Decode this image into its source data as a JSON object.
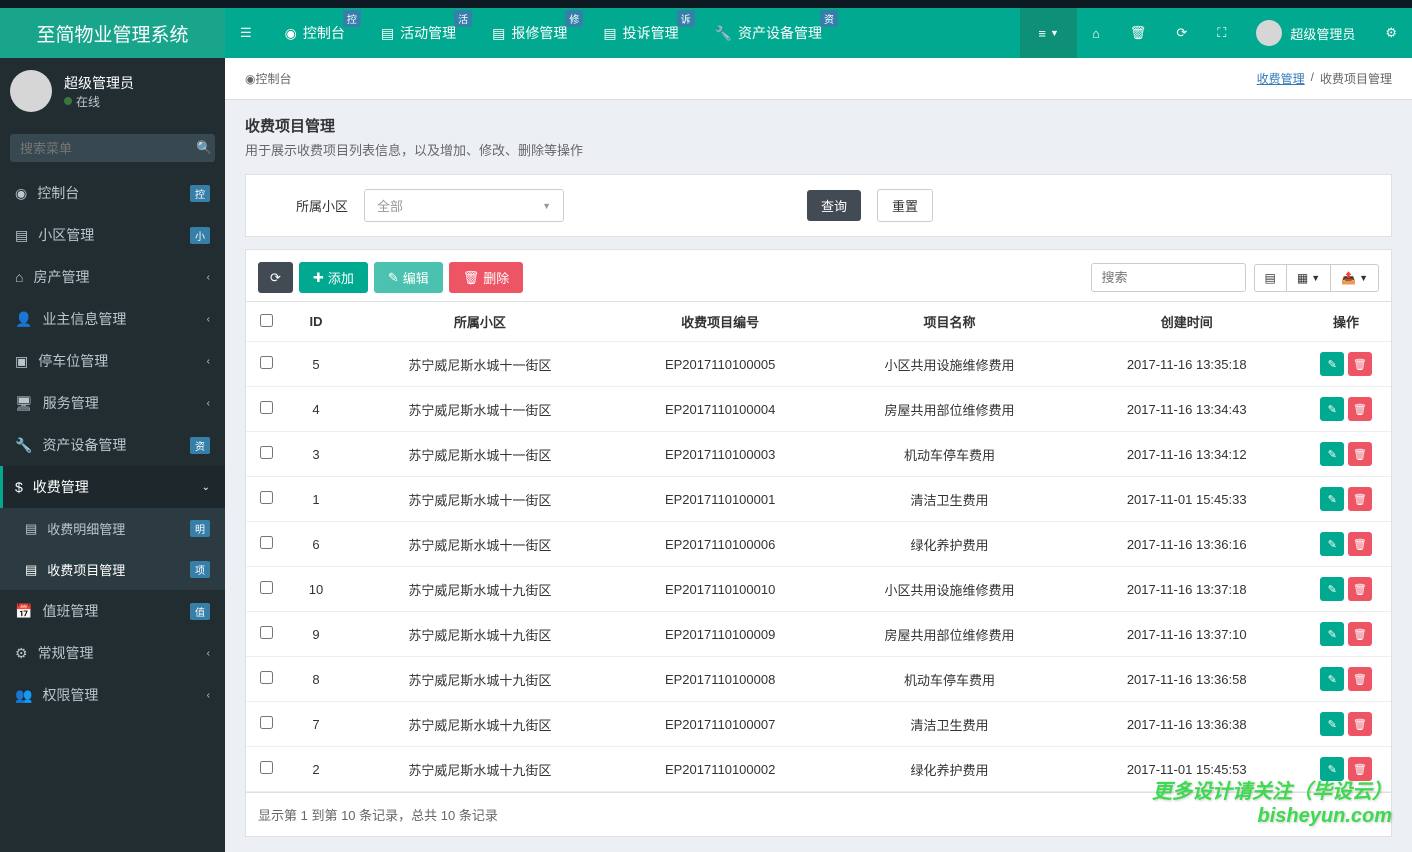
{
  "app_title": "至简物业管理系统",
  "top_nav": [
    {
      "label": "控制台",
      "badge": "控"
    },
    {
      "label": "活动管理",
      "badge": "活"
    },
    {
      "label": "报修管理",
      "badge": "修"
    },
    {
      "label": "投诉管理",
      "badge": "诉"
    },
    {
      "label": "资产设备管理",
      "badge": "资"
    }
  ],
  "user_name": "超级管理员",
  "sidebar": {
    "user_name": "超级管理员",
    "status": "在线",
    "search_placeholder": "搜索菜单",
    "items": [
      {
        "label": "控制台",
        "badge": "控"
      },
      {
        "label": "小区管理",
        "badge": "小"
      },
      {
        "label": "房产管理"
      },
      {
        "label": "业主信息管理"
      },
      {
        "label": "停车位管理"
      },
      {
        "label": "服务管理"
      },
      {
        "label": "资产设备管理",
        "badge": "资"
      },
      {
        "label": "收费管理"
      },
      {
        "label": "值班管理",
        "badge": "值"
      },
      {
        "label": "常规管理"
      },
      {
        "label": "权限管理"
      }
    ],
    "submenu": [
      {
        "label": "收费明细管理",
        "badge": "明"
      },
      {
        "label": "收费项目管理",
        "badge": "项"
      }
    ]
  },
  "breadcrumb": {
    "home": "控制台",
    "parent": "收费管理",
    "current": "收费项目管理"
  },
  "page": {
    "title": "收费项目管理",
    "subtitle": "用于展示收费项目列表信息，以及增加、修改、删除等操作"
  },
  "filter": {
    "label": "所属小区",
    "select_value": "全部",
    "query_btn": "查询",
    "reset_btn": "重置"
  },
  "toolbar": {
    "add": "添加",
    "edit": "编辑",
    "delete": "删除",
    "search_placeholder": "搜索"
  },
  "table": {
    "columns": [
      "",
      "ID",
      "所属小区",
      "收费项目编号",
      "项目名称",
      "创建时间",
      "操作"
    ],
    "rows": [
      {
        "id": "5",
        "community": "苏宁威尼斯水城十一街区",
        "code": "EP2017110100005",
        "name": "小区共用设施维修费用",
        "created": "2017-11-16 13:35:18"
      },
      {
        "id": "4",
        "community": "苏宁威尼斯水城十一街区",
        "code": "EP2017110100004",
        "name": "房屋共用部位维修费用",
        "created": "2017-11-16 13:34:43"
      },
      {
        "id": "3",
        "community": "苏宁威尼斯水城十一街区",
        "code": "EP2017110100003",
        "name": "机动车停车费用",
        "created": "2017-11-16 13:34:12"
      },
      {
        "id": "1",
        "community": "苏宁威尼斯水城十一街区",
        "code": "EP2017110100001",
        "name": "清洁卫生费用",
        "created": "2017-11-01 15:45:33"
      },
      {
        "id": "6",
        "community": "苏宁威尼斯水城十一街区",
        "code": "EP2017110100006",
        "name": "绿化养护费用",
        "created": "2017-11-16 13:36:16"
      },
      {
        "id": "10",
        "community": "苏宁威尼斯水城十九街区",
        "code": "EP2017110100010",
        "name": "小区共用设施维修费用",
        "created": "2017-11-16 13:37:18"
      },
      {
        "id": "9",
        "community": "苏宁威尼斯水城十九街区",
        "code": "EP2017110100009",
        "name": "房屋共用部位维修费用",
        "created": "2017-11-16 13:37:10"
      },
      {
        "id": "8",
        "community": "苏宁威尼斯水城十九街区",
        "code": "EP2017110100008",
        "name": "机动车停车费用",
        "created": "2017-11-16 13:36:58"
      },
      {
        "id": "7",
        "community": "苏宁威尼斯水城十九街区",
        "code": "EP2017110100007",
        "name": "清洁卫生费用",
        "created": "2017-11-16 13:36:38"
      },
      {
        "id": "2",
        "community": "苏宁威尼斯水城十九街区",
        "code": "EP2017110100002",
        "name": "绿化养护费用",
        "created": "2017-11-01 15:45:53"
      }
    ]
  },
  "pagination": "显示第 1 到第 10 条记录，总共 10 条记录",
  "watermark": {
    "line1": "更多设计请关注（毕设云）",
    "line2": "bisheyun.com"
  }
}
